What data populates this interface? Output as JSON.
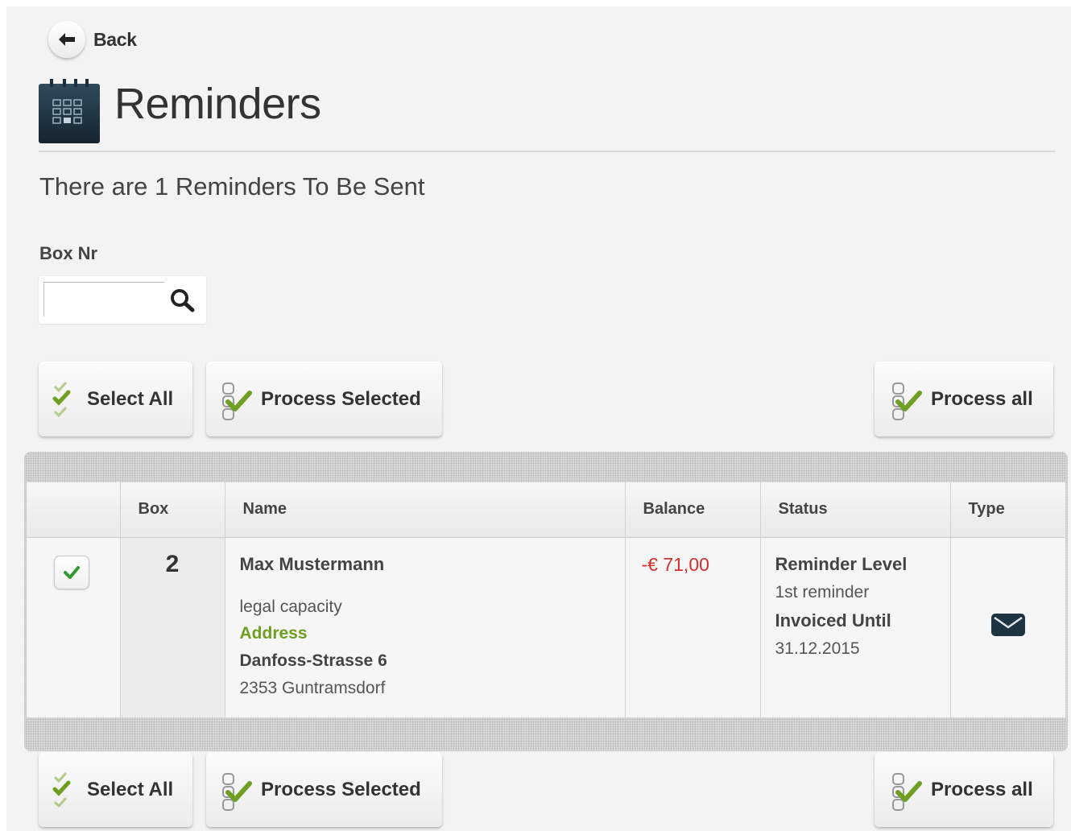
{
  "back": {
    "label": "Back"
  },
  "header": {
    "title": "Reminders",
    "subtitle": "There are 1 Reminders To Be Sent"
  },
  "filter": {
    "label": "Box Nr",
    "value": ""
  },
  "actions": {
    "select_all": "Select All",
    "process_selected": "Process Selected",
    "process_all": "Process all"
  },
  "table": {
    "columns": {
      "box": "Box",
      "name": "Name",
      "balance": "Balance",
      "status": "Status",
      "type": "Type"
    },
    "rows": [
      {
        "selected": true,
        "box": "2",
        "name": "Max Mustermann",
        "legal": "legal capacity",
        "address_heading": "Address",
        "street": "Danfoss-Strasse 6",
        "city": "2353 Guntramsdorf",
        "balance": "-€ 71,00",
        "status_heading": "Reminder Level",
        "status_value": "1st reminder",
        "invoiced_heading": "Invoiced Until",
        "invoiced_value": "31.12.2015",
        "type_icon": "envelope-icon"
      }
    ]
  },
  "colors": {
    "accent_green": "#6f9f22",
    "negative_red": "#d32f2f",
    "icon_dark": "#1f3442"
  }
}
